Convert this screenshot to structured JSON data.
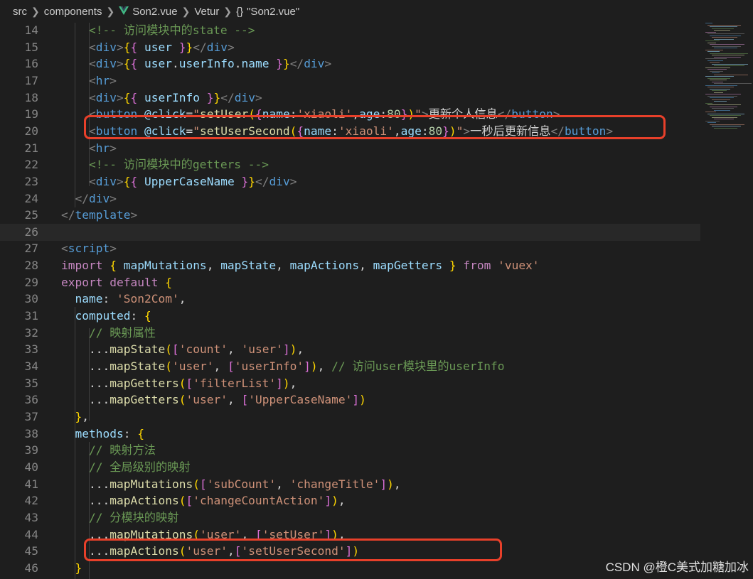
{
  "breadcrumb": {
    "items": [
      "src",
      "components",
      "Son2.vue",
      "Vetur",
      "\"Son2.vue\""
    ],
    "vue_icon": "vue-logo-icon",
    "json_icon": "braces-icon"
  },
  "line_numbers": [
    "14",
    "15",
    "16",
    "17",
    "18",
    "19",
    "20",
    "21",
    "22",
    "23",
    "24",
    "25",
    "26",
    "27",
    "28",
    "29",
    "30",
    "31",
    "32",
    "33",
    "34",
    "35",
    "36",
    "37",
    "38",
    "39",
    "40",
    "41",
    "42",
    "43",
    "44",
    "45",
    "46"
  ],
  "code_lines": [
    "    <!-- 访问模块中的state -->",
    "    <div>{{ user }}</div>",
    "    <div>{{ user.userInfo.name }}</div>",
    "    <hr>",
    "    <div>{{ userInfo }}</div>",
    "    <button @click=\"setUser({name:'xiaoli',age:80})\">更新个人信息</button>",
    "    <button @click=\"setUserSecond({name:'xiaoli',age:80})\">一秒后更新信息</button>",
    "    <hr>",
    "    <!-- 访问模块中的getters -->",
    "    <div>{{ UpperCaseName }}</div>",
    "  </div>",
    "</template>",
    "",
    "<script>",
    "import { mapMutations, mapState, mapActions, mapGetters } from 'vuex'",
    "export default {",
    "  name: 'Son2Com',",
    "  computed: {",
    "    // 映射属性",
    "    ...mapState(['count', 'user']),",
    "    ...mapState('user', ['userInfo']), // 访问user模块里的userInfo",
    "    ...mapGetters(['filterList']),",
    "    ...mapGetters('user', ['UpperCaseName'])",
    "  },",
    "  methods: {",
    "    // 映射方法",
    "    // 全局级别的映射",
    "    ...mapMutations(['subCount', 'changeTitle']),",
    "    ...mapActions(['changeCountAction']),",
    "    // 分模块的映射",
    "    ...mapMutations('user', ['setUser']),",
    "    ...mapActions('user',['setUserSecond'])",
    "  }"
  ],
  "current_line": "26",
  "highlighted_lines": [
    "20",
    "45"
  ],
  "colors": {
    "background": "#1e1e1e",
    "highlight_box": "#e8402a",
    "line_number": "#858585",
    "vue_logo": "#41b883"
  },
  "watermark": "CSDN @橙C美式加糖加冰"
}
